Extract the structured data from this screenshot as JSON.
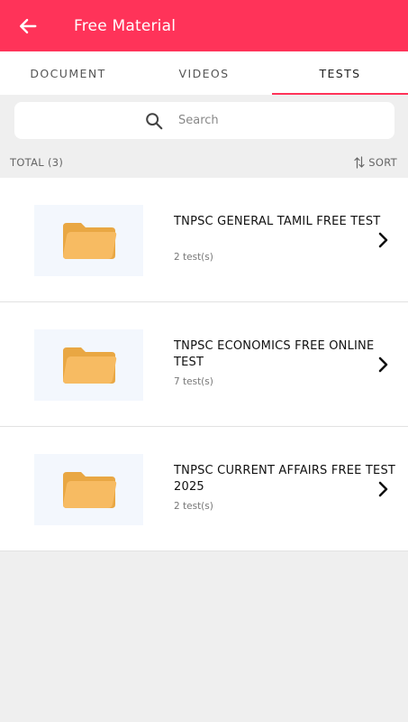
{
  "app_bar": {
    "title": "Free Material",
    "back_icon": "arrow-left-icon",
    "color": "#ff3359"
  },
  "tabs": [
    {
      "label": "DOCUMENT",
      "active": false
    },
    {
      "label": "VIDEOS",
      "active": false
    },
    {
      "label": "TESTS",
      "active": true
    }
  ],
  "search": {
    "placeholder": "Search",
    "value": "",
    "icon": "search-icon"
  },
  "list_meta": {
    "total": "TOTAL (3)",
    "sort": "SORT"
  },
  "items": [
    {
      "title": "TNPSC GENERAL TAMIL FREE TEST",
      "count": "2 test(s)",
      "icon": "folder-icon"
    },
    {
      "title": "TNPSC ECONOMICS FREE ONLINE TEST",
      "count": "7 test(s)",
      "icon": "folder-icon"
    },
    {
      "title": "TNPSC CURRENT AFFAIRS FREE TEST 2025",
      "count": "2 test(s)",
      "icon": "folder-icon"
    }
  ]
}
